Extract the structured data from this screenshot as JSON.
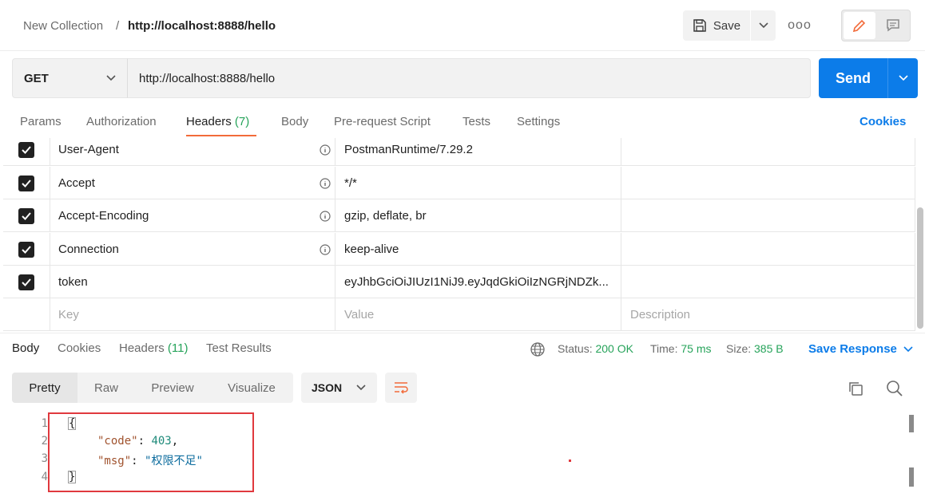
{
  "breadcrumb": {
    "collection": "New Collection",
    "separator": "/",
    "current": "http://localhost:8888/hello"
  },
  "toolbar": {
    "save_label": "Save",
    "more_label": "ooo"
  },
  "request": {
    "method": "GET",
    "url": "http://localhost:8888/hello",
    "send_label": "Send"
  },
  "request_tabs": {
    "params": "Params",
    "authorization": "Authorization",
    "headers": "Headers",
    "headers_count": "(7)",
    "body": "Body",
    "prerequest": "Pre-request Script",
    "tests": "Tests",
    "settings": "Settings",
    "cookies": "Cookies"
  },
  "headers": [
    {
      "key": "User-Agent",
      "value": "PostmanRuntime/7.29.2",
      "checked": true,
      "info": true
    },
    {
      "key": "Accept",
      "value": "*/*",
      "checked": true,
      "info": true
    },
    {
      "key": "Accept-Encoding",
      "value": "gzip, deflate, br",
      "checked": true,
      "info": true
    },
    {
      "key": "Connection",
      "value": "keep-alive",
      "checked": true,
      "info": true
    },
    {
      "key": "token",
      "value": "eyJhbGciOiJIUzI1NiJ9.eyJqdGkiOiIzNGRjNDZk...",
      "checked": true,
      "info": false
    }
  ],
  "header_placeholders": {
    "key": "Key",
    "value": "Value",
    "description": "Description"
  },
  "response_tabs": {
    "body": "Body",
    "cookies": "Cookies",
    "headers": "Headers",
    "headers_count": "(11)",
    "test_results": "Test Results"
  },
  "response_meta": {
    "status_label": "Status:",
    "status_value": "200 OK",
    "time_label": "Time:",
    "time_value": "75 ms",
    "size_label": "Size:",
    "size_value": "385 B",
    "save_response": "Save Response"
  },
  "view_modes": {
    "pretty": "Pretty",
    "raw": "Raw",
    "preview": "Preview",
    "visualize": "Visualize"
  },
  "format": "JSON",
  "code": {
    "line_numbers": [
      "1",
      "2",
      "3",
      "4"
    ],
    "open_brace": "{",
    "code_key": "\"code\"",
    "code_colon": ": ",
    "code_value": "403",
    "code_comma": ",",
    "msg_key": "\"msg\"",
    "msg_colon": ": ",
    "msg_value": "\"权限不足\"",
    "close_brace": "}"
  },
  "colors": {
    "accent_send": "#0c7ce9",
    "tab_underline": "#f26b3a",
    "status_ok": "#26a35a",
    "highlight": "#e0393e"
  }
}
